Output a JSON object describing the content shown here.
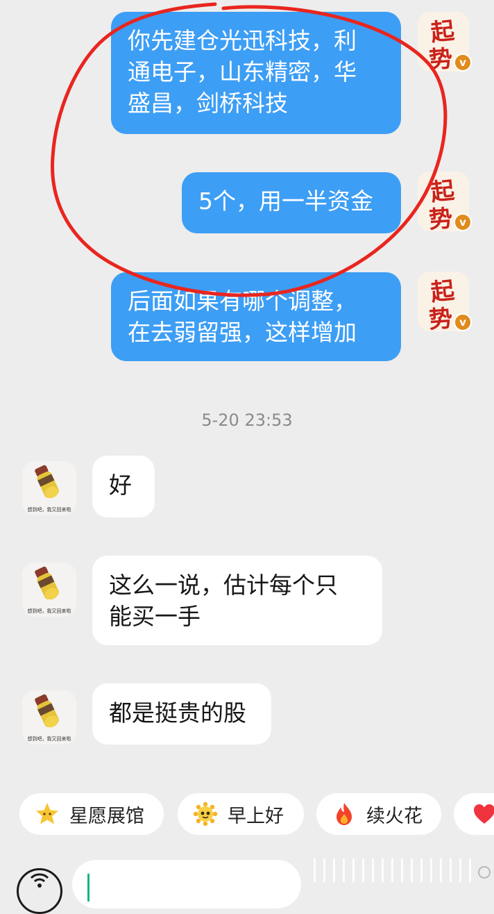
{
  "messages": [
    {
      "side": "right",
      "text": "你先建仓光迅科技，利\n通电子，山东精密，华\n盛昌，剑桥科技"
    },
    {
      "side": "right",
      "text": "5个，用一半资金"
    },
    {
      "side": "right",
      "text": "后面如果有哪个调整，\n在去弱留强，这样增加"
    },
    {
      "side": "left",
      "text": "好"
    },
    {
      "side": "left",
      "text": "这么一说，估计每个只\n能买一手"
    },
    {
      "side": "left",
      "text": "都是挺贵的股"
    }
  ],
  "timestamp": "5-20 23:53",
  "avatars": {
    "right_text": "起势",
    "right_badge": "v",
    "left_caption": "想到吧，我又回来啦"
  },
  "quick_replies": [
    {
      "label": "星愿展馆",
      "icon": "star-face-icon"
    },
    {
      "label": "早上好",
      "icon": "sun-face-icon"
    },
    {
      "label": "续火花",
      "icon": "flame-icon"
    },
    {
      "label": "",
      "icon": "heart-icon"
    }
  ],
  "input": {
    "value": "",
    "placeholder": ""
  },
  "colors": {
    "bubble_me": "#3d9ef5",
    "bubble_them": "#ffffff",
    "background": "#ededed",
    "annotation": "#e8261f",
    "avatar_red": "#c9221a"
  }
}
